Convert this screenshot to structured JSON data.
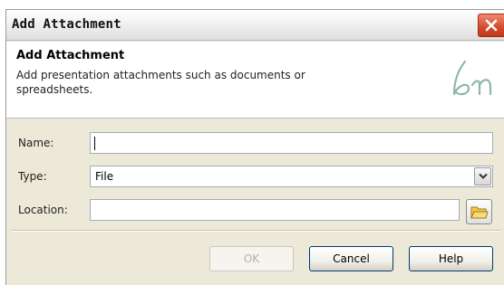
{
  "window": {
    "title": "Add Attachment"
  },
  "header": {
    "title": "Add Attachment",
    "description": "Add presentation attachments such as documents or spreadsheets.",
    "logo_icon": "signature-logo-icon"
  },
  "form": {
    "name": {
      "label": "Name:",
      "value": ""
    },
    "type": {
      "label": "Type:",
      "selected": "File"
    },
    "location": {
      "label": "Location:",
      "value": ""
    }
  },
  "buttons": {
    "ok": "OK",
    "cancel": "Cancel",
    "help": "Help"
  },
  "colors": {
    "close_button": "#d14a2d",
    "dialog_bg": "#ece9d8",
    "button_border": "#003c74"
  }
}
